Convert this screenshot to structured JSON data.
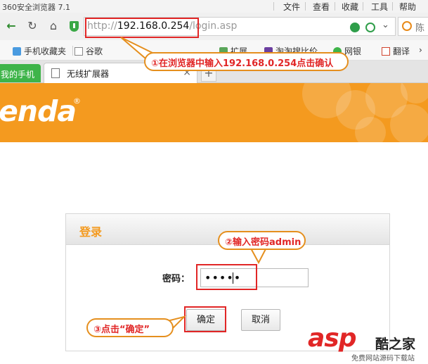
{
  "window": {
    "app_title": "360安全浏览器 7.1",
    "menu": [
      "文件",
      "查看",
      "收藏",
      "工具",
      "帮助"
    ]
  },
  "address_bar": {
    "url_proto": "http://",
    "url_host": "192.168.0.254",
    "url_path": "/login.asp",
    "search_text": "陈"
  },
  "bookmarks": [
    {
      "label": "手机收藏夹"
    },
    {
      "label": "谷歌"
    },
    {
      "label": "扩展"
    },
    {
      "label": "淘淘搜比价"
    },
    {
      "label": "网银"
    },
    {
      "label": "翻译"
    }
  ],
  "tabs": [
    {
      "label": "我的手机"
    },
    {
      "label": "无线扩展器"
    }
  ],
  "tab_new_label": "+",
  "tab_close_label": "×",
  "brand": {
    "logo_text": "enda",
    "logo_mark": "®",
    "accent": "#f49a1f"
  },
  "login": {
    "title": "登录",
    "password_label": "密码：",
    "password_value": "•••••",
    "ok_label": "确定",
    "cancel_label": "取消"
  },
  "callouts": {
    "step1": "①在浏览器中输入192.168.0.254点击确认",
    "step2": "②输入密码admin",
    "step3": "③点击“确定”"
  },
  "watermark": {
    "brand": "asp",
    "brand_suffix": "酷之家",
    "tagline": "免费网站源码下载站"
  },
  "colors": {
    "highlight_red": "#e12626",
    "tab_green": "#3eb449",
    "callout_border": "#e58f1e"
  }
}
